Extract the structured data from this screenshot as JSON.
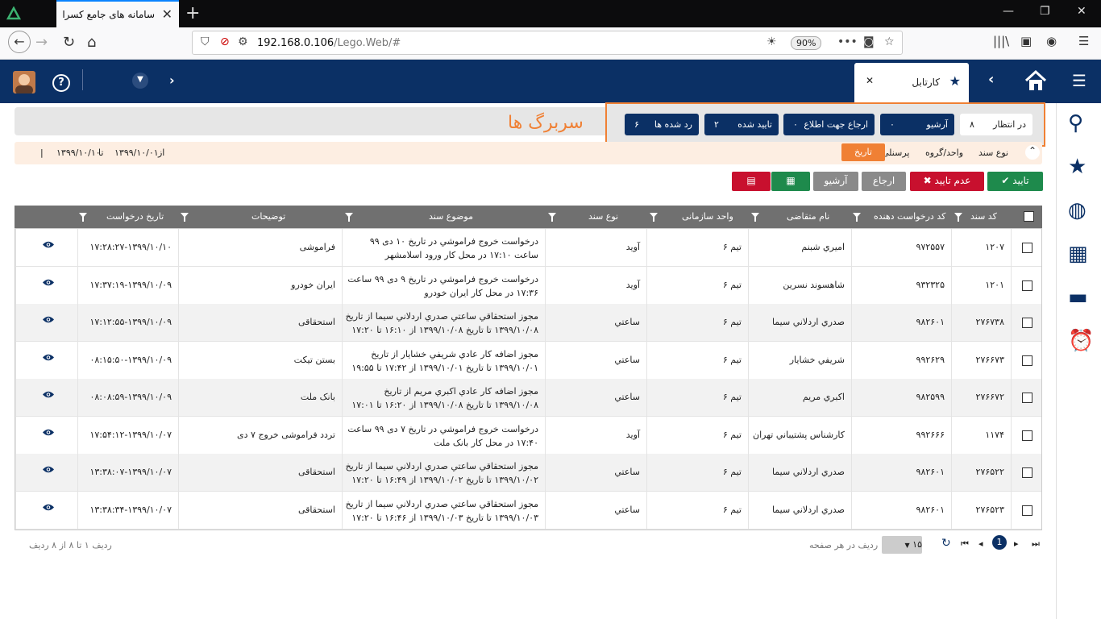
{
  "browser": {
    "tab_title": "سامانه های جامع کسرا",
    "url_host": "192.168.0.106",
    "url_path": "/Lego.Web/#",
    "zoom": "90%"
  },
  "app": {
    "active_tab": "کارتابل",
    "page_title": "سربرگ ها"
  },
  "status_buttons": [
    {
      "label": "در انتظار",
      "count": "۸"
    },
    {
      "label": "آرشیو",
      "count": "۰"
    },
    {
      "label": "ارجاع جهت اطلاع",
      "count": "۰"
    },
    {
      "label": "تایید شده",
      "count": "۲"
    },
    {
      "label": "رد شده ها",
      "count": "۶"
    }
  ],
  "filter": {
    "label_type": "نوع سند",
    "unit_group": "واحد/گروه",
    "personnel": "پرسنلی",
    "date": "تاریخ",
    "range_from": "از",
    "from_date": "۱۳۹۹/۱۰/۰۱",
    "range_to": "تا",
    "to_date": "۱۳۹۹/۱۰/۱۰",
    "sep": "|"
  },
  "actions": {
    "approve": "تایید",
    "reject": "عدم تایید",
    "refer": "ارجاع",
    "archive": "آرشیو"
  },
  "columns": [
    "کد سند",
    "کد درخواست دهنده",
    "نام متقاضی",
    "واحد سازمانی",
    "نوع سند",
    "موضوع سند",
    "توضیحات",
    "تاریخ درخواست"
  ],
  "rows": [
    {
      "code": "۱۲۰۷",
      "req": "۹۷۲۵۵۷",
      "name": "اميري شبنم",
      "unit": "تیم ۶",
      "type": "آويد",
      "subject": "درخواست خروج فراموشي در تاريخ ۱۰ دی ۹۹ ساعت ۱۷:۱۰ در محل کار ورود اسلامشهر",
      "desc": "فراموشی",
      "date": "۱۷:۲۸:۲۷-۱۳۹۹/۱۰/۱۰"
    },
    {
      "code": "۱۲۰۱",
      "req": "۹۳۲۳۲۵",
      "name": "شاهسوند نسرين",
      "unit": "تیم ۶",
      "type": "آويد",
      "subject": "درخواست خروج فراموشي در تاريخ ۹ دی ۹۹ ساعت ۱۷:۳۶ در محل کار ايران خودرو",
      "desc": "ایران خودرو",
      "date": "۱۷:۳۷:۱۹-۱۳۹۹/۱۰/۰۹"
    },
    {
      "code": "۲۷۶۷۳۸",
      "req": "۹۸۲۶۰۱",
      "name": "صدري اردلاني سيما",
      "unit": "تیم ۶",
      "type": "ساعتي",
      "subject": "مجوز استحقاقي ساعتي صدري اردلاني سيما از تاريخ ۱۳۹۹/۱۰/۰۸ تا تاريخ ۱۳۹۹/۱۰/۰۸ از ۱۶:۱۰ تا ۱۷:۲۰",
      "desc": "استحقاقی",
      "date": "۱۷:۱۲:۵۵-۱۳۹۹/۱۰/۰۹"
    },
    {
      "code": "۲۷۶۶۷۳",
      "req": "۹۹۲۶۲۹",
      "name": "شريفي خشايار",
      "unit": "تیم ۶",
      "type": "ساعتي",
      "subject": "مجوز اضافه کار عادي شريفي خشايار از تاريخ ۱۳۹۹/۱۰/۰۱ تا تاريخ ۱۳۹۹/۱۰/۰۱ از ۱۷:۴۲ تا ۱۹:۵۵",
      "desc": "بستن تیکت",
      "date": "۰۸:۱۵:۵۰-۱۳۹۹/۱۰/۰۹"
    },
    {
      "code": "۲۷۶۶۷۲",
      "req": "۹۸۲۵۹۹",
      "name": "اکبري مريم",
      "unit": "تیم ۶",
      "type": "ساعتي",
      "subject": "مجوز اضافه کار عادي اکبري مريم از تاريخ ۱۳۹۹/۱۰/۰۸ تا تاريخ ۱۳۹۹/۱۰/۰۸ از ۱۶:۲۰ تا ۱۷:۰۱",
      "desc": "بانک ملت",
      "date": "۰۸:۰۸:۵۹-۱۳۹۹/۱۰/۰۹"
    },
    {
      "code": "۱۱۷۴",
      "req": "۹۹۲۶۶۶",
      "name": "کارشناس پشتيباني تهران",
      "unit": "تیم ۶",
      "type": "آويد",
      "subject": "درخواست خروج فراموشي در تاريخ ۷ دی ۹۹ ساعت ۱۷:۴۰ در محل کار بانک ملت",
      "desc": "تردد فراموشی خروج ۷ دی",
      "date": "۱۷:۵۴:۱۲-۱۳۹۹/۱۰/۰۷"
    },
    {
      "code": "۲۷۶۵۲۲",
      "req": "۹۸۲۶۰۱",
      "name": "صدري اردلاني سيما",
      "unit": "تیم ۶",
      "type": "ساعتي",
      "subject": "مجوز استحقاقي ساعتي صدري اردلاني سيما از تاريخ ۱۳۹۹/۱۰/۰۲ تا تاريخ ۱۳۹۹/۱۰/۰۲ از ۱۶:۴۹ تا ۱۷:۲۰",
      "desc": "استحقاقی",
      "date": "۱۳:۳۸:۰۷-۱۳۹۹/۱۰/۰۷"
    },
    {
      "code": "۲۷۶۵۲۳",
      "req": "۹۸۲۶۰۱",
      "name": "صدري اردلاني سيما",
      "unit": "تیم ۶",
      "type": "ساعتي",
      "subject": "مجوز استحقاقي ساعتي صدري اردلاني سيما از تاريخ ۱۳۹۹/۱۰/۰۳ تا تاريخ ۱۳۹۹/۱۰/۰۳ از ۱۶:۴۶ تا ۱۷:۲۰",
      "desc": "استحقاقی",
      "date": "۱۳:۳۸:۳۴-۱۳۹۹/۱۰/۰۷"
    }
  ],
  "pager": {
    "page": "1",
    "page_size": "۱۵",
    "per_page_label": "ردیف در هر صفحه",
    "summary": "ردیف ۱ تا ۸ از ۸ ردیف"
  },
  "colors": {
    "header": "#0b3065",
    "accent": "#f08034",
    "approve": "#1e8a4c",
    "reject": "#c8102e",
    "neutral": "#8a8a8a"
  }
}
